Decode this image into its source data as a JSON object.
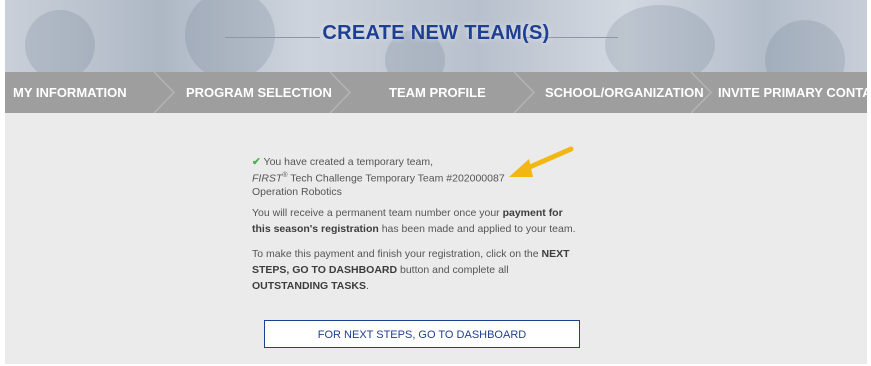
{
  "banner": {
    "title": "CREATE NEW TEAM(S)"
  },
  "steps": [
    {
      "label": "MY INFORMATION"
    },
    {
      "label": "PROGRAM SELECTION"
    },
    {
      "label": "TEAM PROFILE"
    },
    {
      "label": "SCHOOL/ORGANIZATION"
    },
    {
      "label": "INVITE PRIMARY CONTACTS"
    }
  ],
  "message": {
    "check_icon": "✔",
    "created_text": "You have created a temporary team,",
    "team_first": "FIRST",
    "team_reg": "®",
    "team_rest": " Tech Challenge Temporary Team #202000087",
    "team_org": "Operation Robotics",
    "p1_a": "You will receive a permanent team number once your ",
    "p1_b": "payment for this season's registration",
    "p1_c": " has been made and applied to your team.",
    "p2_a": "To make this payment and finish your registration, click on the ",
    "p2_b": "NEXT STEPS, GO TO DASHBOARD",
    "p2_c": " button and complete all ",
    "p2_d": "OUTSTANDING TASKS",
    "p2_e": "."
  },
  "button": {
    "label": "FOR NEXT STEPS, GO TO DASHBOARD"
  },
  "colors": {
    "brand_blue": "#1f3f93",
    "steps_bg": "#9e9e9e",
    "content_bg": "#ebebeb",
    "check_green": "#4cae4c",
    "arrow": "#f2b711"
  },
  "icons": {
    "check": "check-icon",
    "annotation": "arrow-annotation-icon",
    "separator": "chevron-right-icon"
  }
}
